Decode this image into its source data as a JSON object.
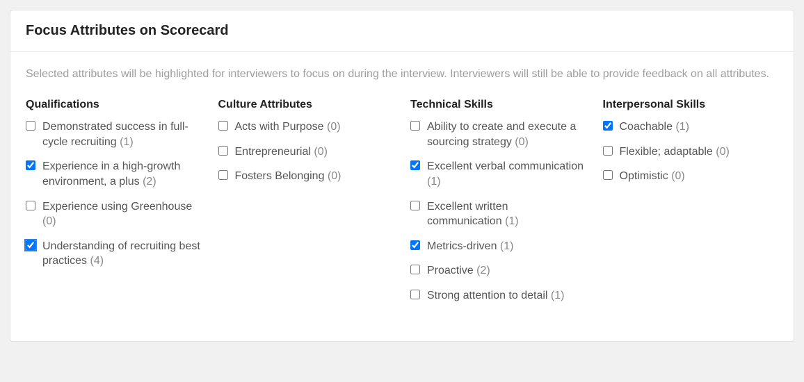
{
  "header": {
    "title": "Focus Attributes on Scorecard"
  },
  "description": "Selected attributes will be highlighted for interviewers to focus on during the interview. Interviewers will still be able to provide feedback on all attributes.",
  "columns": [
    {
      "heading": "Qualifications",
      "items": [
        {
          "label": "Demonstrated success in full-cycle recruiting",
          "count": 1,
          "checked": false,
          "focused": false
        },
        {
          "label": "Experience in a high-growth environment, a plus",
          "count": 2,
          "checked": true,
          "focused": false
        },
        {
          "label": "Experience using Greenhouse",
          "count": 0,
          "checked": false,
          "focused": false
        },
        {
          "label": "Understanding of recruiting best practices",
          "count": 4,
          "checked": true,
          "focused": true
        }
      ]
    },
    {
      "heading": "Culture Attributes",
      "items": [
        {
          "label": "Acts with Purpose",
          "count": 0,
          "checked": false,
          "focused": false
        },
        {
          "label": "Entrepreneurial",
          "count": 0,
          "checked": false,
          "focused": false
        },
        {
          "label": "Fosters Belonging",
          "count": 0,
          "checked": false,
          "focused": false
        }
      ]
    },
    {
      "heading": "Technical Skills",
      "items": [
        {
          "label": "Ability to create and execute a sourcing strategy",
          "count": 0,
          "checked": false,
          "focused": false
        },
        {
          "label": "Excellent verbal communication",
          "count": 1,
          "checked": true,
          "focused": false
        },
        {
          "label": "Excellent written communication",
          "count": 1,
          "checked": false,
          "focused": false
        },
        {
          "label": "Metrics-driven",
          "count": 1,
          "checked": true,
          "focused": false
        },
        {
          "label": "Proactive",
          "count": 2,
          "checked": false,
          "focused": false
        },
        {
          "label": "Strong attention to detail",
          "count": 1,
          "checked": false,
          "focused": false
        }
      ]
    },
    {
      "heading": "Interpersonal Skills",
      "items": [
        {
          "label": "Coachable",
          "count": 1,
          "checked": true,
          "focused": false
        },
        {
          "label": "Flexible; adaptable",
          "count": 0,
          "checked": false,
          "focused": false
        },
        {
          "label": "Optimistic",
          "count": 0,
          "checked": false,
          "focused": false
        }
      ]
    }
  ]
}
